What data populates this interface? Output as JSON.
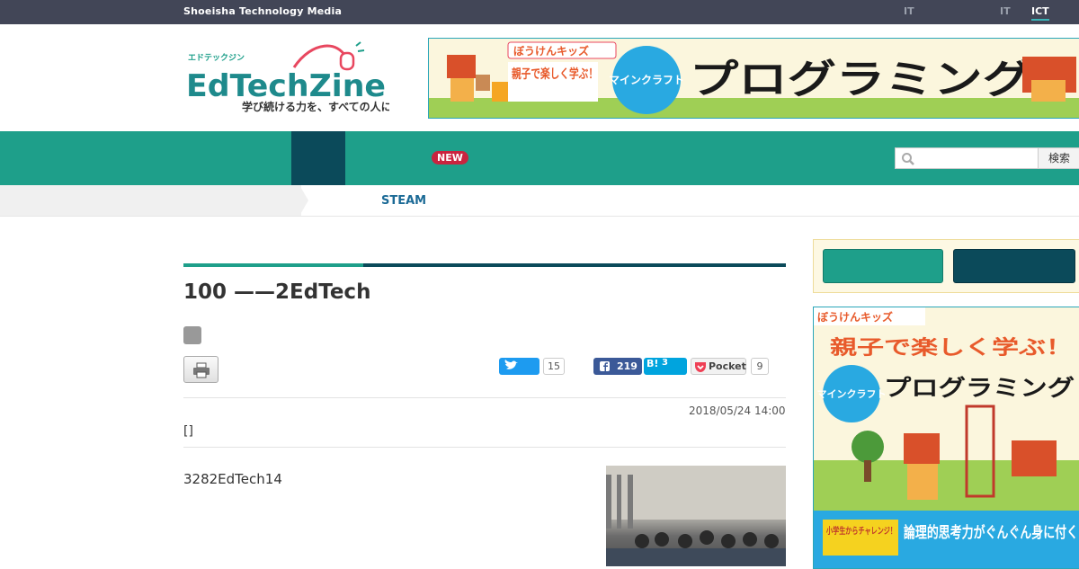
{
  "topbar": {
    "brand": "Shoeisha Technology Media",
    "links": [
      "IT",
      "IT",
      "ICT"
    ]
  },
  "logo": {
    "kana": "エドテックジン",
    "name": "EdTechZine",
    "tagline": "学び続ける力を、すべての人に"
  },
  "banner_top": {
    "badge": "ぼうけんキッズ",
    "left_text": "親子で楽しく学ぶ！",
    "circle_text": "マインクラフト",
    "headline": "プログラミング"
  },
  "nav": {
    "new_badge": "NEW",
    "search_placeholder": "",
    "search_button": "検索"
  },
  "breadcrumb": {
    "category": "STEAM"
  },
  "article": {
    "title": "100 ——2EdTech",
    "date": "2018/05/24 14:00",
    "bracket": "[]",
    "lead": "3282EdTech14"
  },
  "share": {
    "twitter_count": "15",
    "facebook_count": "219",
    "hatena_label": "B!",
    "hatena_count": "3",
    "pocket_label": "Pocket",
    "pocket_count": "9"
  },
  "banner_side": {
    "badge": "ぼうけんキッズ",
    "top_text": "親子で楽しく学ぶ！",
    "circle_text": "マインクラフト",
    "headline": "プログラミング",
    "footer_left": "小学生からチャレンジ！",
    "footer_right": "論理的思考力がぐんぐん身に付く"
  },
  "colors": {
    "topbar": "#424657",
    "nav_green": "#1e9f8a",
    "nav_dark": "#0b4a5a",
    "new_badge": "#c9243f",
    "steam_link": "#1b6a96"
  }
}
